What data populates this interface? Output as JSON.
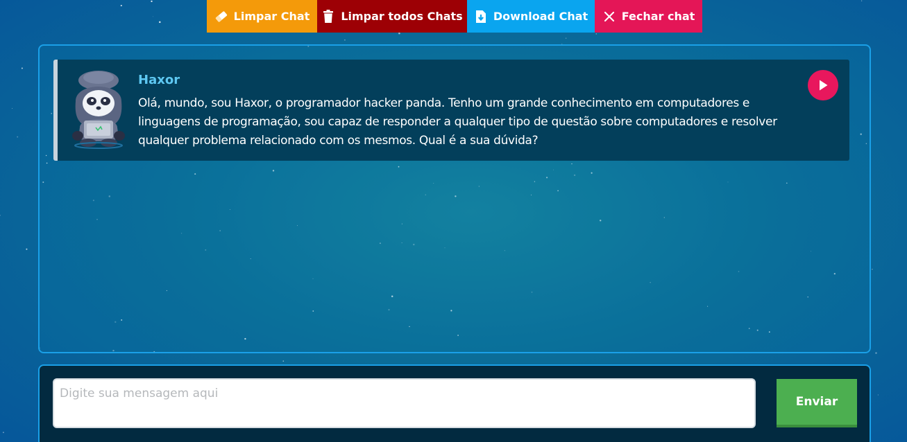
{
  "toolbar": {
    "clear_label": "Limpar Chat",
    "clear_all_label": "Limpar todos Chats",
    "download_label": "Download Chat",
    "close_label": "Fechar chat"
  },
  "chat": {
    "messages": [
      {
        "sender": "Haxor",
        "text": "Olá, mundo, sou Haxor, o programador hacker panda. Tenho um grande conhecimento em computadores e linguagens de programação, sou capaz de responder a qualquer tipo de questão sobre computadores e resolver qualquer problema relacionado com os mesmos. Qual é a sua dúvida?"
      }
    ]
  },
  "composer": {
    "placeholder": "Digite sua mensagem aqui",
    "value": "",
    "send_label": "Enviar"
  },
  "icons": {
    "clear": "eraser-icon",
    "clear_all": "trash-icon",
    "download": "download-file-icon",
    "close": "close-icon",
    "play": "play-icon"
  },
  "colors": {
    "clear_button": "#f49a0a",
    "clear_all_button": "#9d0005",
    "download_button": "#0aa5ef",
    "close_button": "#e41657",
    "play_button": "#e8175d",
    "send_button": "#4caf50",
    "sender_name": "#5ec8f2",
    "message_bg": "#033f5b",
    "border_accent": "#1aa0e8"
  }
}
